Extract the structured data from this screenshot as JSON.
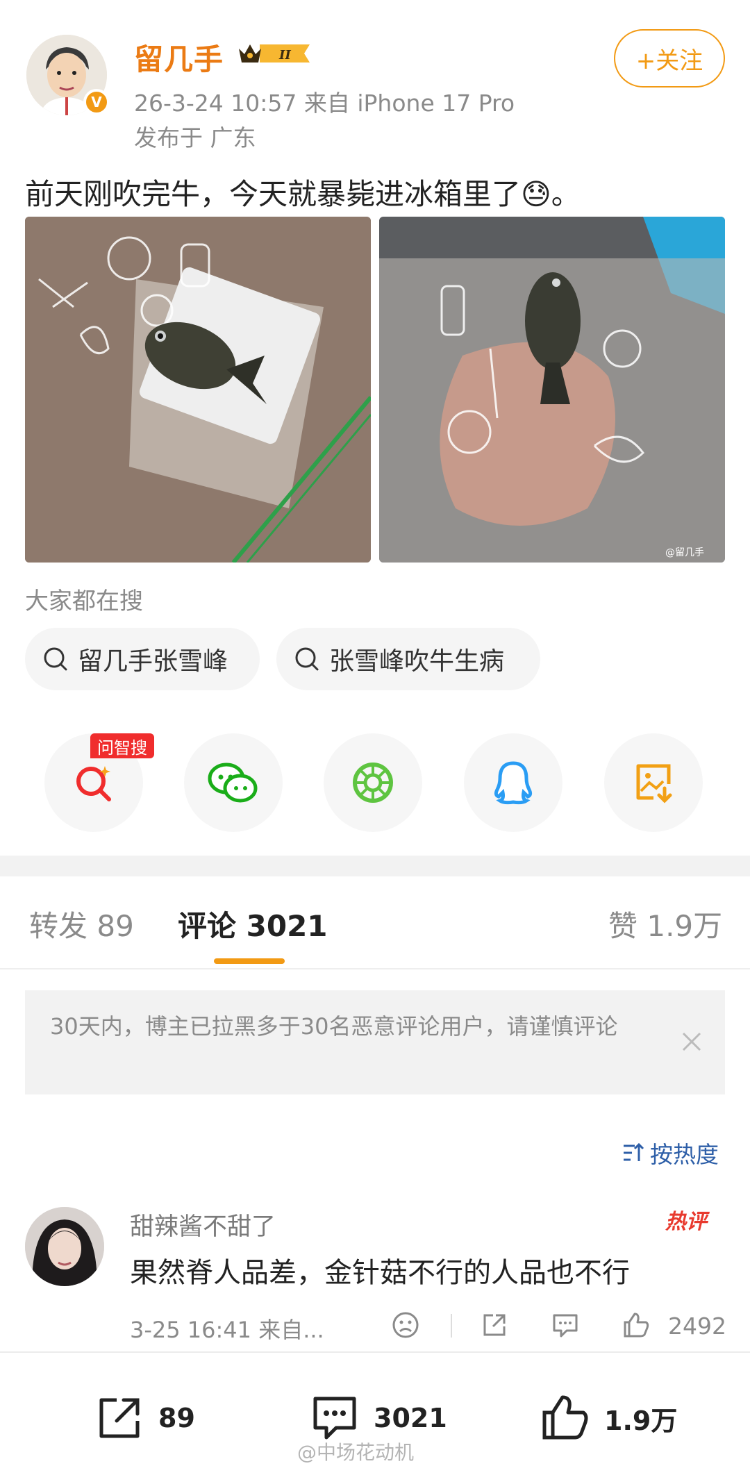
{
  "post": {
    "username": "留几手",
    "level_badge": "II",
    "datetime_source": "26-3-24 10:57  来自 iPhone 17 Pro",
    "location": "发布于 广东",
    "follow_label": "+关注",
    "text": "前天刚吹完牛，今天就暴毙进冰箱里了😓。",
    "image_watermark": "@留几手"
  },
  "hot_search": {
    "label": "大家都在搜",
    "items": [
      "留几手张雪峰",
      "张雪峰吹牛生病"
    ]
  },
  "share": {
    "ai_badge": "问智搜",
    "icons": [
      "ai-search-icon",
      "wechat-icon",
      "moments-icon",
      "qq-icon",
      "save-image-icon"
    ],
    "colors": {
      "ai": "#f02d2d",
      "wechat": "#1aad19",
      "moments": "#5ec440",
      "qq": "#2a9df4",
      "save": "#f2a014"
    }
  },
  "tabs": {
    "repost": "转发 89",
    "comment": "评论 3021",
    "like": "赞 1.9万"
  },
  "notice": {
    "text": "30天内，博主已拉黑多于30名恶意评论用户，请谨慎评论"
  },
  "sort": {
    "label": "按热度"
  },
  "comment": {
    "name": "甜辣酱不甜了",
    "hot_badge": "热评",
    "text": "果然脊人品差，金针菇不行的人品也不行",
    "meta": "3-25 16:41  来自...",
    "likes": "2492"
  },
  "bottom_bar": {
    "repost_count": "89",
    "comment_count": "3021",
    "like_count": "1.9万",
    "watermark": "@中场花动机"
  },
  "colors": {
    "accent": "#f29a14",
    "username": "#eb7b14",
    "link": "#2e5fa8",
    "hot": "#e83a2e"
  }
}
